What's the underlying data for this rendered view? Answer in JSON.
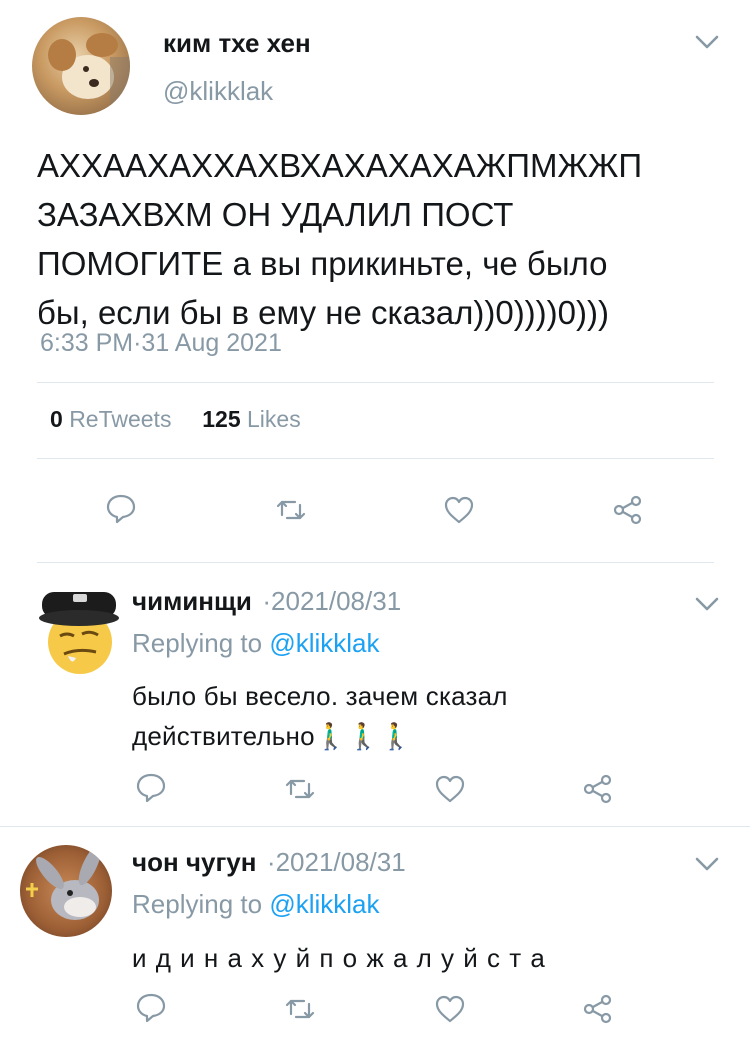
{
  "main_tweet": {
    "author_name": "ким тхе хен",
    "handle": "@klikklak",
    "text_lines": [
      "АХХААХАХХАХВХАХАХАХАЖПМЖЖП",
      "ЗАЗАХВХМ ОН УДАЛИЛ ПОСТ",
      "ПОМОГИТЕ а вы прикиньте, че было",
      "бы, если бы в ему не сказал))0))))0)))"
    ],
    "timestamp": "6:33 PM·31 Aug 2021",
    "retweets_count": "0",
    "retweets_label": "ReTweets",
    "likes_count": "125",
    "likes_label": "Likes"
  },
  "replies": [
    {
      "author_name": "чиминщи",
      "date": "·2021/08/31",
      "replying_prefix": "Replying to",
      "replying_handle": "@klikklak",
      "text_lines": [
        "было бы весело. зачем сказал",
        "действительно🚶‍♂️🚶‍♂️🚶‍♂️"
      ]
    },
    {
      "author_name": "чон чугун",
      "date": "·2021/08/31",
      "replying_prefix": "Replying to",
      "replying_handle": "@klikklak",
      "text_lines": [
        "и д и н а х у й п о ж а л у й с т а"
      ]
    }
  ],
  "icons": [
    "reply-icon",
    "retweet-icon",
    "like-icon",
    "share-icon",
    "chevron-down-icon"
  ],
  "colors": {
    "text": "#14171a",
    "secondary": "#8899a6",
    "link": "#1da1f2",
    "divider": "#e1e8ed"
  }
}
